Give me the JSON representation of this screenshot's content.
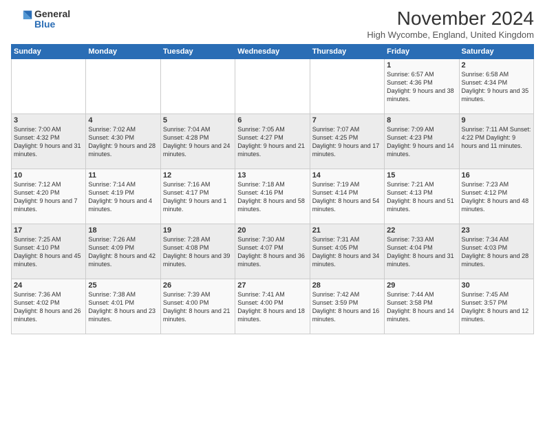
{
  "logo": {
    "general": "General",
    "blue": "Blue"
  },
  "header": {
    "month": "November 2024",
    "location": "High Wycombe, England, United Kingdom"
  },
  "weekdays": [
    "Sunday",
    "Monday",
    "Tuesday",
    "Wednesday",
    "Thursday",
    "Friday",
    "Saturday"
  ],
  "weeks": [
    [
      {
        "day": "",
        "info": ""
      },
      {
        "day": "",
        "info": ""
      },
      {
        "day": "",
        "info": ""
      },
      {
        "day": "",
        "info": ""
      },
      {
        "day": "",
        "info": ""
      },
      {
        "day": "1",
        "info": "Sunrise: 6:57 AM\nSunset: 4:36 PM\nDaylight: 9 hours\nand 38 minutes."
      },
      {
        "day": "2",
        "info": "Sunrise: 6:58 AM\nSunset: 4:34 PM\nDaylight: 9 hours\nand 35 minutes."
      }
    ],
    [
      {
        "day": "3",
        "info": "Sunrise: 7:00 AM\nSunset: 4:32 PM\nDaylight: 9 hours\nand 31 minutes."
      },
      {
        "day": "4",
        "info": "Sunrise: 7:02 AM\nSunset: 4:30 PM\nDaylight: 9 hours\nand 28 minutes."
      },
      {
        "day": "5",
        "info": "Sunrise: 7:04 AM\nSunset: 4:28 PM\nDaylight: 9 hours\nand 24 minutes."
      },
      {
        "day": "6",
        "info": "Sunrise: 7:05 AM\nSunset: 4:27 PM\nDaylight: 9 hours\nand 21 minutes."
      },
      {
        "day": "7",
        "info": "Sunrise: 7:07 AM\nSunset: 4:25 PM\nDaylight: 9 hours\nand 17 minutes."
      },
      {
        "day": "8",
        "info": "Sunrise: 7:09 AM\nSunset: 4:23 PM\nDaylight: 9 hours\nand 14 minutes."
      },
      {
        "day": "9",
        "info": "Sunrise: 7:11 AM\nSunset: 4:22 PM\nDaylight: 9 hours\nand 11 minutes."
      }
    ],
    [
      {
        "day": "10",
        "info": "Sunrise: 7:12 AM\nSunset: 4:20 PM\nDaylight: 9 hours\nand 7 minutes."
      },
      {
        "day": "11",
        "info": "Sunrise: 7:14 AM\nSunset: 4:19 PM\nDaylight: 9 hours\nand 4 minutes."
      },
      {
        "day": "12",
        "info": "Sunrise: 7:16 AM\nSunset: 4:17 PM\nDaylight: 9 hours\nand 1 minute."
      },
      {
        "day": "13",
        "info": "Sunrise: 7:18 AM\nSunset: 4:16 PM\nDaylight: 8 hours\nand 58 minutes."
      },
      {
        "day": "14",
        "info": "Sunrise: 7:19 AM\nSunset: 4:14 PM\nDaylight: 8 hours\nand 54 minutes."
      },
      {
        "day": "15",
        "info": "Sunrise: 7:21 AM\nSunset: 4:13 PM\nDaylight: 8 hours\nand 51 minutes."
      },
      {
        "day": "16",
        "info": "Sunrise: 7:23 AM\nSunset: 4:12 PM\nDaylight: 8 hours\nand 48 minutes."
      }
    ],
    [
      {
        "day": "17",
        "info": "Sunrise: 7:25 AM\nSunset: 4:10 PM\nDaylight: 8 hours\nand 45 minutes."
      },
      {
        "day": "18",
        "info": "Sunrise: 7:26 AM\nSunset: 4:09 PM\nDaylight: 8 hours\nand 42 minutes."
      },
      {
        "day": "19",
        "info": "Sunrise: 7:28 AM\nSunset: 4:08 PM\nDaylight: 8 hours\nand 39 minutes."
      },
      {
        "day": "20",
        "info": "Sunrise: 7:30 AM\nSunset: 4:07 PM\nDaylight: 8 hours\nand 36 minutes."
      },
      {
        "day": "21",
        "info": "Sunrise: 7:31 AM\nSunset: 4:05 PM\nDaylight: 8 hours\nand 34 minutes."
      },
      {
        "day": "22",
        "info": "Sunrise: 7:33 AM\nSunset: 4:04 PM\nDaylight: 8 hours\nand 31 minutes."
      },
      {
        "day": "23",
        "info": "Sunrise: 7:34 AM\nSunset: 4:03 PM\nDaylight: 8 hours\nand 28 minutes."
      }
    ],
    [
      {
        "day": "24",
        "info": "Sunrise: 7:36 AM\nSunset: 4:02 PM\nDaylight: 8 hours\nand 26 minutes."
      },
      {
        "day": "25",
        "info": "Sunrise: 7:38 AM\nSunset: 4:01 PM\nDaylight: 8 hours\nand 23 minutes."
      },
      {
        "day": "26",
        "info": "Sunrise: 7:39 AM\nSunset: 4:00 PM\nDaylight: 8 hours\nand 21 minutes."
      },
      {
        "day": "27",
        "info": "Sunrise: 7:41 AM\nSunset: 4:00 PM\nDaylight: 8 hours\nand 18 minutes."
      },
      {
        "day": "28",
        "info": "Sunrise: 7:42 AM\nSunset: 3:59 PM\nDaylight: 8 hours\nand 16 minutes."
      },
      {
        "day": "29",
        "info": "Sunrise: 7:44 AM\nSunset: 3:58 PM\nDaylight: 8 hours\nand 14 minutes."
      },
      {
        "day": "30",
        "info": "Sunrise: 7:45 AM\nSunset: 3:57 PM\nDaylight: 8 hours\nand 12 minutes."
      }
    ]
  ]
}
